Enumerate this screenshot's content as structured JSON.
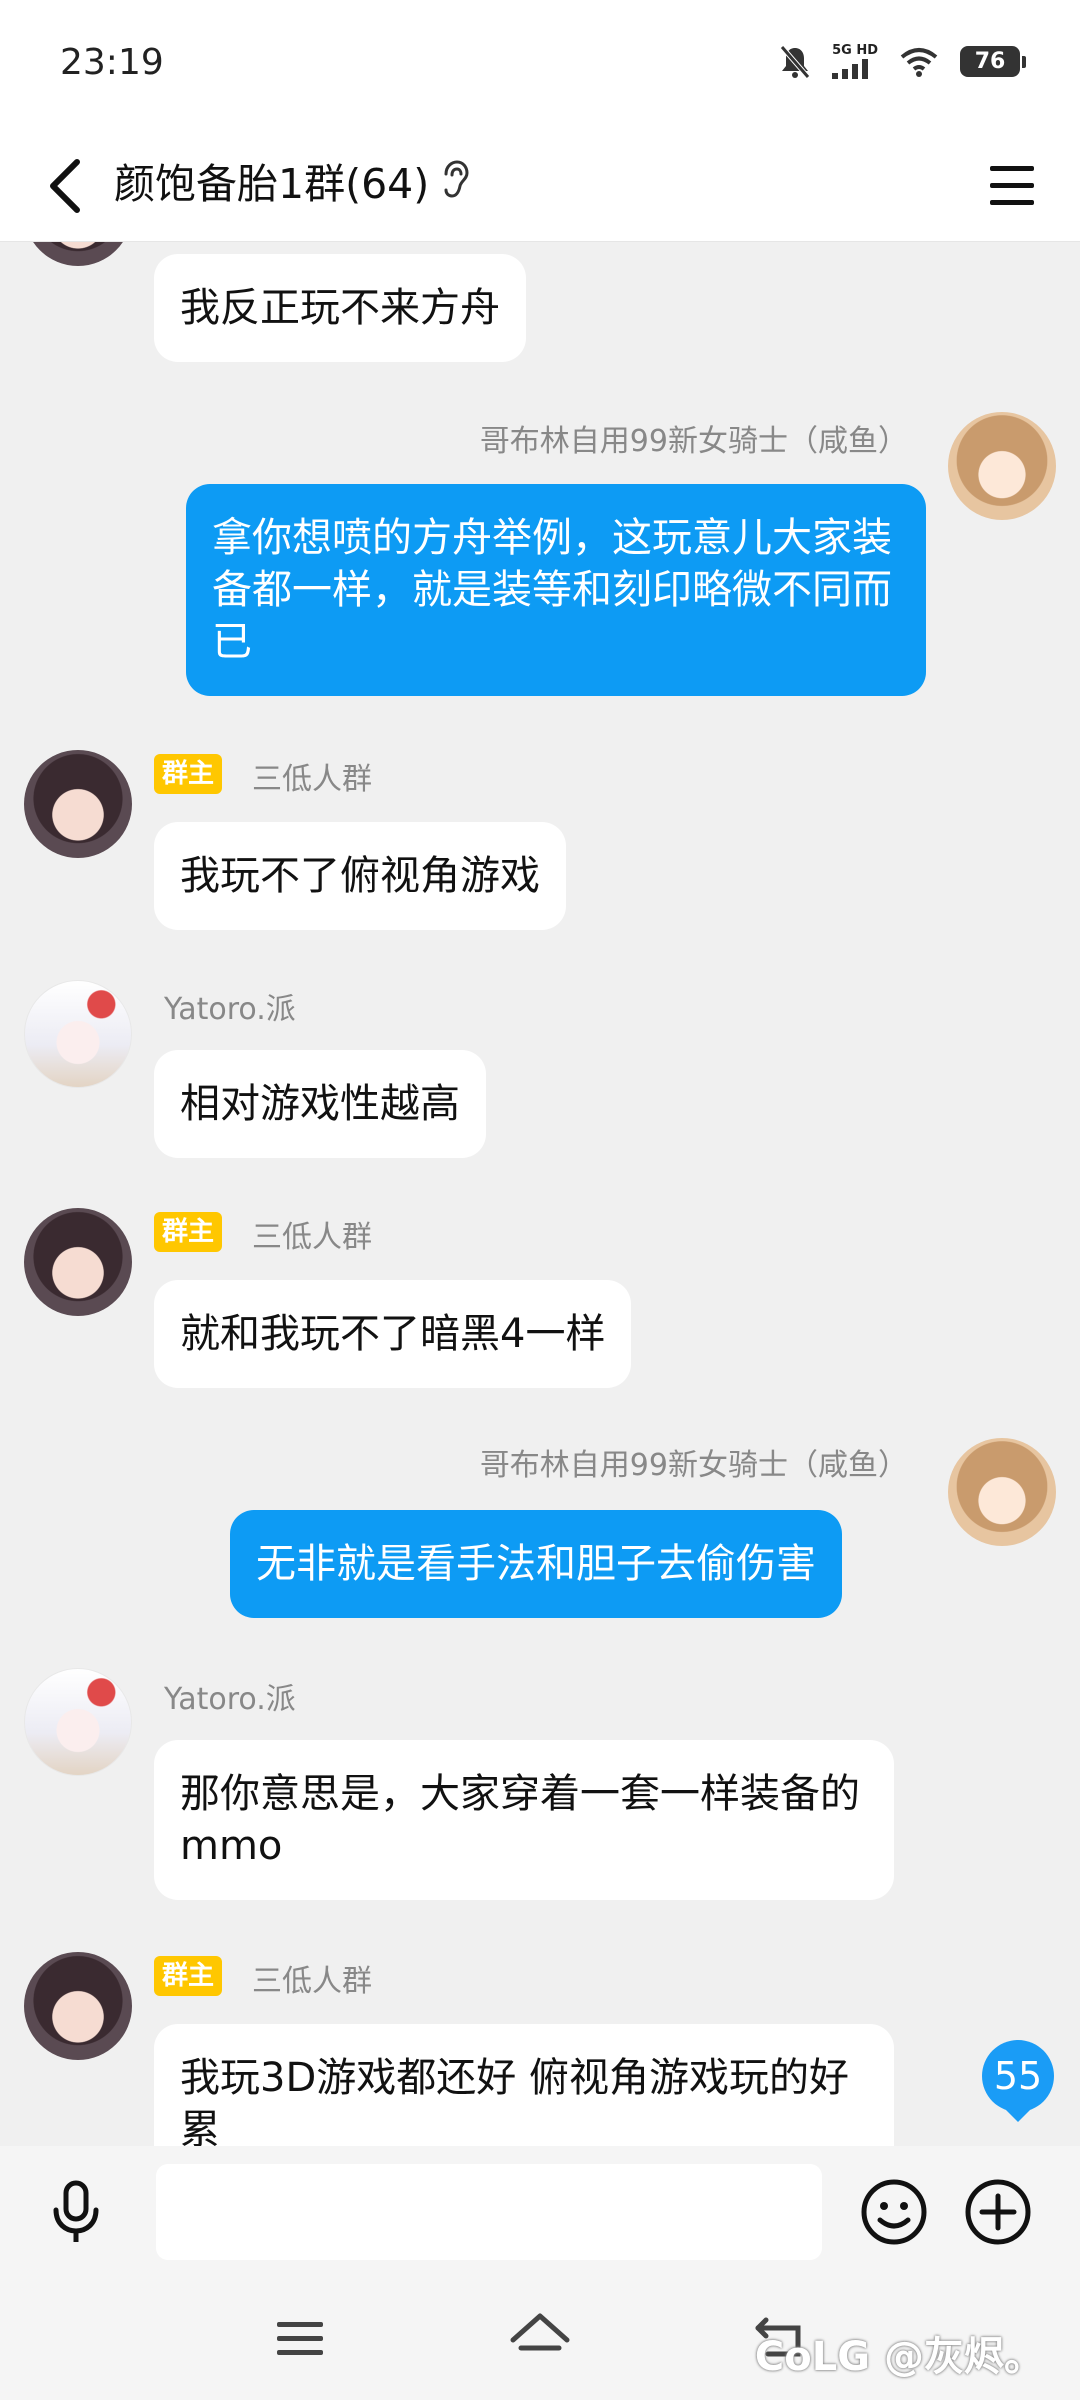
{
  "status": {
    "time": "23:19",
    "network": "5G HD",
    "battery": "76"
  },
  "header": {
    "title": "颜饱备胎1群(64)"
  },
  "messages": [
    {
      "id": "m0",
      "sender": "",
      "text": "我反正玩不来方舟"
    },
    {
      "id": "m1",
      "sender": "哥布林自用99新女骑士（咸鱼）",
      "text": "拿你想喷的方舟举例，这玩意儿大家装备都一样，就是装等和刻印略微不同而已"
    },
    {
      "id": "m2",
      "badge": "群主",
      "sender": "三低人群",
      "text": "我玩不了俯视角游戏"
    },
    {
      "id": "m3",
      "sender": "Yatoro.派",
      "text": "相对游戏性越高"
    },
    {
      "id": "m4",
      "badge": "群主",
      "sender": "三低人群",
      "text": "就和我玩不了暗黑4一样"
    },
    {
      "id": "m5",
      "sender": "哥布林自用99新女骑士（咸鱼）",
      "text": "无非就是看手法和胆子去偷伤害"
    },
    {
      "id": "m6",
      "sender": "Yatoro.派",
      "text": "那你意思是，大家穿着一套一样装备的mmo"
    },
    {
      "id": "m7",
      "badge": "群主",
      "sender": "三低人群",
      "text": "我玩3D游戏都还好  俯视角游戏玩的好累"
    }
  ],
  "unread_count": "55",
  "input": {
    "placeholder": ""
  },
  "watermark": "CoLG @灰烬。",
  "icons": [
    "back-arrow-icon",
    "ear-icon",
    "menu-icon",
    "mic-icon",
    "emoji-icon",
    "plus-icon",
    "nav-menu-icon",
    "nav-home-icon",
    "nav-back-icon",
    "mute-icon",
    "signal-icon",
    "wifi-icon"
  ],
  "colors": {
    "self_bubble": "#0d9bf4",
    "owner_badge": "#ffc700",
    "unread_badge": "#1a9cf6"
  }
}
